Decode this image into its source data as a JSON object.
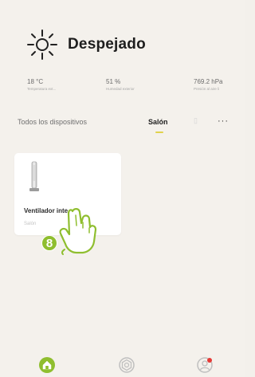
{
  "weather": {
    "title": "Despejado",
    "icon": "sun-icon"
  },
  "metrics": [
    {
      "value": "18 °C",
      "label": "Temperatura ext..."
    },
    {
      "value": "51 %",
      "label": "Humedad exterior"
    },
    {
      "value": "769.2 hPa",
      "label": "Presión al aire li"
    }
  ],
  "tabs": {
    "all_label": "Todos los dispositivos",
    "active_label": "Salón",
    "active_underline_color": "#e0d24c",
    "more_label": "···"
  },
  "device": {
    "name": "Ventilador inte...",
    "room": "Salón",
    "icon": "tower-fan-icon"
  },
  "tutorial": {
    "step": "8",
    "badge_color": "#8fbe2f",
    "icon": "tap-hand-icon"
  },
  "bottom_nav": {
    "items": [
      {
        "icon": "home-icon",
        "active": true,
        "color": "#8fbe2f"
      },
      {
        "icon": "scenes-icon",
        "active": false
      },
      {
        "icon": "profile-icon",
        "active": false,
        "badge_color": "#e53935"
      }
    ]
  }
}
